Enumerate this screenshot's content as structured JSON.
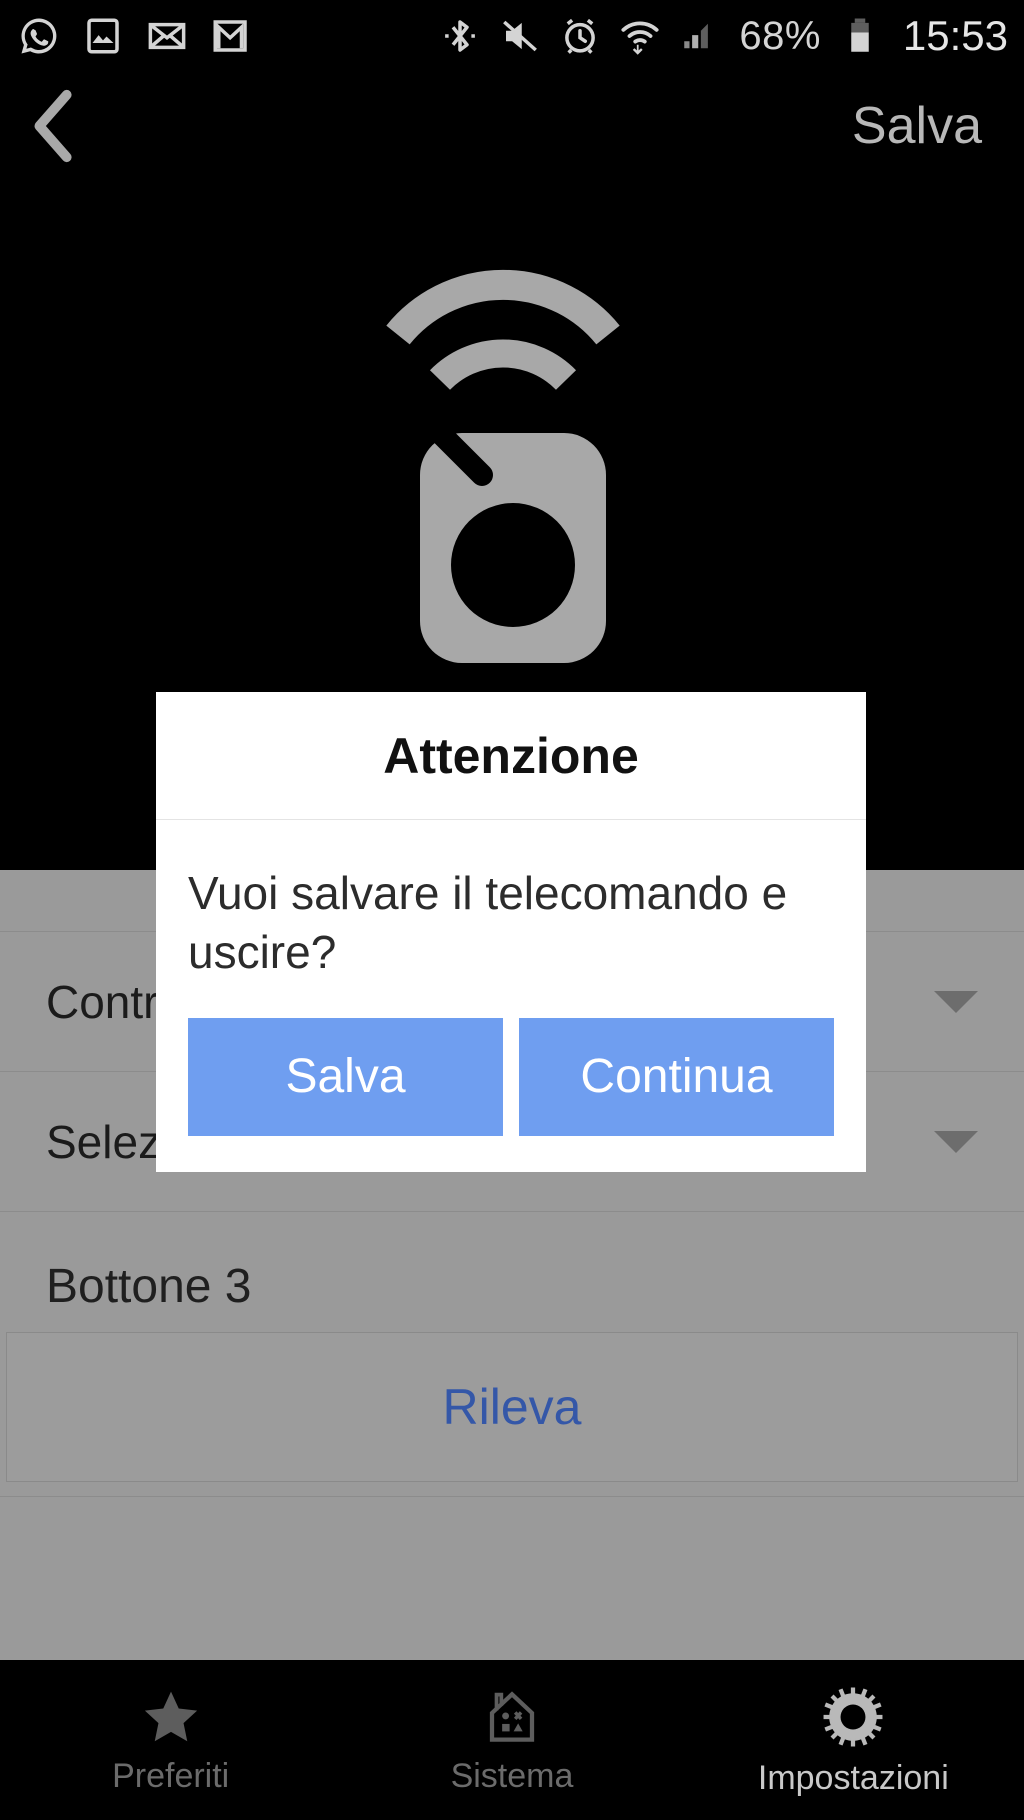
{
  "statusbar": {
    "left_icons": [
      "whatsapp-icon",
      "gallery-icon",
      "envelope-icon",
      "gmail-icon"
    ],
    "right_icons": [
      "bluetooth-icon",
      "volume-muted-icon",
      "alarm-icon",
      "wifi-icon",
      "cellular-signal-icon"
    ],
    "battery_percent": "68%",
    "clock": "15:53"
  },
  "navbar": {
    "back_icon": "chevron-left-icon",
    "save_label": "Salva"
  },
  "hero": {
    "icon": "remote-control-signal-icon"
  },
  "form": {
    "control_row_label": "Contr",
    "automation_row_label": "Seleziona automazione",
    "section_label": "Bottone 3",
    "detect_label": "Rileva",
    "caret_icon": "chevron-down-icon"
  },
  "dialog": {
    "title": "Attenzione",
    "message": "Vuoi salvare il telecomando e uscire?",
    "primary_label": "Salva",
    "secondary_label": "Continua",
    "button_color": "#6f9ef0"
  },
  "tabbar": {
    "items": [
      {
        "label": "Preferiti",
        "icon": "star-icon",
        "active": false
      },
      {
        "label": "Sistema",
        "icon": "house-icon",
        "active": false
      },
      {
        "label": "Impostazioni",
        "icon": "gear-icon",
        "active": true
      }
    ]
  },
  "colors": {
    "background": "#000000",
    "dimmed_panel": "#9a9a9a",
    "accent_blue": "#6f9ef0",
    "link_blue": "#3457a8",
    "status_text": "#d4d4d4"
  }
}
